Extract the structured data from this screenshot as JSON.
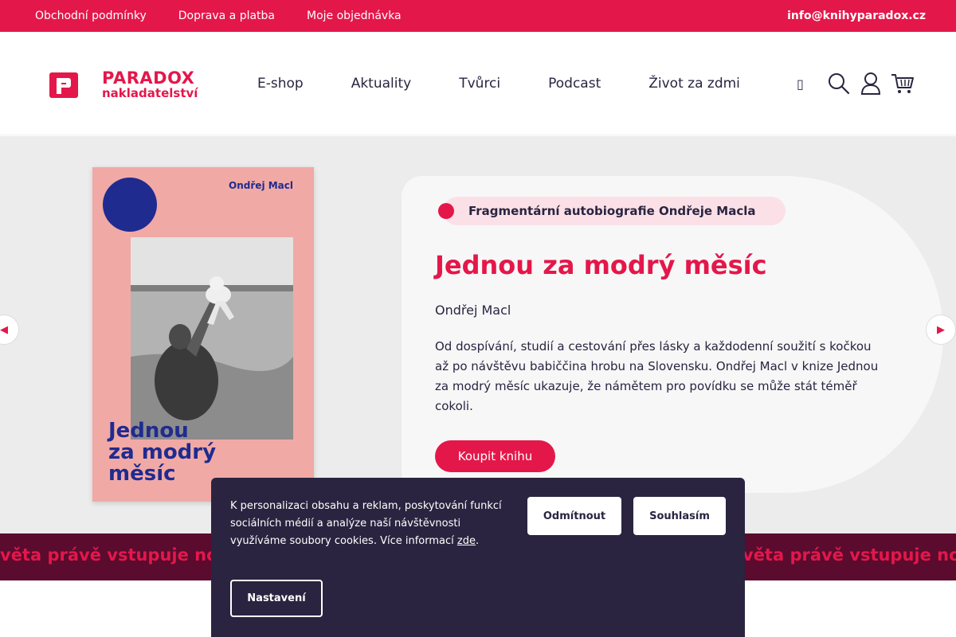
{
  "topbar": {
    "links": [
      "Obchodní podmínky",
      "Doprava a platba",
      "Moje objednávka"
    ],
    "email": "info@knihyparadox.cz"
  },
  "header": {
    "logo_line1": "PARADOX",
    "logo_line2": "nakladatelství",
    "nav": [
      "E-shop",
      "Aktuality",
      "Tvůrci",
      "Podcast",
      "Život za zdmi"
    ],
    "icons": [
      "search-icon",
      "user-icon",
      "cart-icon"
    ]
  },
  "hero": {
    "tag": "Fragmentární autobiografie Ondřeje Macla",
    "title": "Jednou za modrý měsíc",
    "author": "Ondřej Macl",
    "description": "Od dospívání, studií a cestování přes lásky a každodenní soužití s kočkou až po návštěvu babiččina hrobu na Slovensku. Ondřej Macl v knize Jednou za modrý měsíc ukazuje, že námětem pro povídku se může stát téměř cokoli.",
    "buy_label": "Koupit knihu",
    "cover": {
      "author": "Ondřej Macl",
      "title_l1": "Jednou",
      "title_l2": "za modrý",
      "title_l3": "měsíc"
    }
  },
  "ticker": {
    "text": "věta právě vstupuje nova"
  },
  "cookie": {
    "text": "K personalizaci obsahu a reklam, poskytování funkcí sociálních médií a analýze naší návštěvnosti využíváme soubory cookies. Více informací ",
    "link": "zde",
    "after": ".",
    "refuse_label": "Odmítnout",
    "agree_label": "Souhlasím",
    "settings_label": "Nastavení"
  },
  "colors": {
    "brand": "#e4174a",
    "dark": "#2a2440",
    "ticker_bg": "#5a0b2e",
    "cover_pink": "#f1a9a6",
    "cover_blue": "#1f2b8f"
  }
}
